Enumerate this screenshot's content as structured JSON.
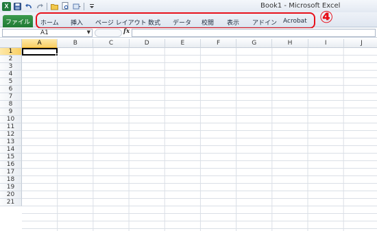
{
  "window": {
    "title": "Book1 - Microsoft Excel"
  },
  "quick_access": {
    "icons": [
      "excel-icon",
      "save-icon",
      "undo-icon",
      "redo-icon",
      "open-icon",
      "print-preview-icon",
      "customize-icon"
    ]
  },
  "ribbon": {
    "file_label": "ファイル",
    "tabs": [
      {
        "label": "ホーム"
      },
      {
        "label": "挿入"
      },
      {
        "label": "ページ レイアウト"
      },
      {
        "label": "数式"
      },
      {
        "label": "データ"
      },
      {
        "label": "校閲"
      },
      {
        "label": "表示"
      },
      {
        "label": "アドイン"
      },
      {
        "label": "Acrobat"
      }
    ],
    "callout": "④",
    "highlight_color": "#e8101a"
  },
  "formula_bar": {
    "name_box": "A1",
    "fx_label": "fx",
    "formula": ""
  },
  "sheet": {
    "columns": [
      "A",
      "B",
      "C",
      "D",
      "E",
      "F",
      "G",
      "H",
      "I",
      "J"
    ],
    "rows": [
      "1",
      "2",
      "3",
      "4",
      "5",
      "6",
      "7",
      "8",
      "9",
      "10",
      "11",
      "12",
      "13",
      "14",
      "15",
      "16",
      "17",
      "18",
      "19",
      "20",
      "21"
    ],
    "selected_cell": "A1"
  }
}
